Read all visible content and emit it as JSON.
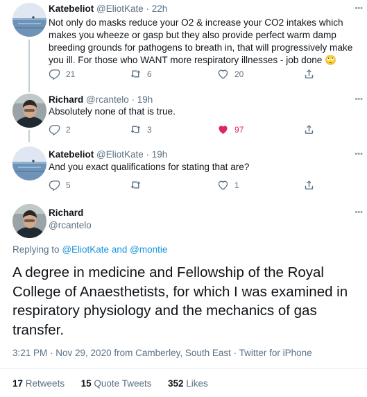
{
  "tweets": [
    {
      "name": "Katebeliot",
      "handle": "@EliotKate",
      "time": "· 22h",
      "text": "Not only do masks reduce your O2 & increase your CO2 intakes which makes you wheeze or gasp but they also provide perfect warm damp breeding grounds for pathogens to breath in, that will progressively make you ill. For those who WANT more respiratory illnesses - job done",
      "emoji": "🙄",
      "replies": "21",
      "retweets": "6",
      "likes": "20"
    },
    {
      "name": "Richard",
      "handle": "@rcantelo",
      "time": "· 19h",
      "text": "Absolutely none of that is true.",
      "replies": "2",
      "retweets": "3",
      "likes": "97"
    },
    {
      "name": "Katebeliot",
      "handle": "@EliotKate",
      "time": "· 19h",
      "text": "And you exact qualifications for stating that are?",
      "replies": "5",
      "retweets": "",
      "likes": "1"
    }
  ],
  "main": {
    "name": "Richard",
    "handle": "@rcantelo",
    "replying_prefix": "Replying to",
    "replying_user1": "@EliotKate",
    "replying_and": "and",
    "replying_user2": "@montie",
    "text": "A degree in medicine and Fellowship of the Royal College of Anaesthetists, for which I was examined in respiratory physiology and the mechanics of gas transfer.",
    "meta": "3:21 PM · Nov 29, 2020 from Camberley, South East · Twitter for iPhone",
    "retweets_count": "17",
    "retweets_label": "Retweets",
    "quotes_count": "15",
    "quotes_label": "Quote Tweets",
    "likes_count": "352",
    "likes_label": "Likes"
  },
  "colors": {
    "link": "#1b95e0",
    "like_active": "#e0245e",
    "secondary": "#5b7083"
  },
  "icons": {
    "more": "more-icon",
    "reply": "reply-icon",
    "retweet": "retweet-icon",
    "like": "heart-icon",
    "share": "share-icon"
  }
}
